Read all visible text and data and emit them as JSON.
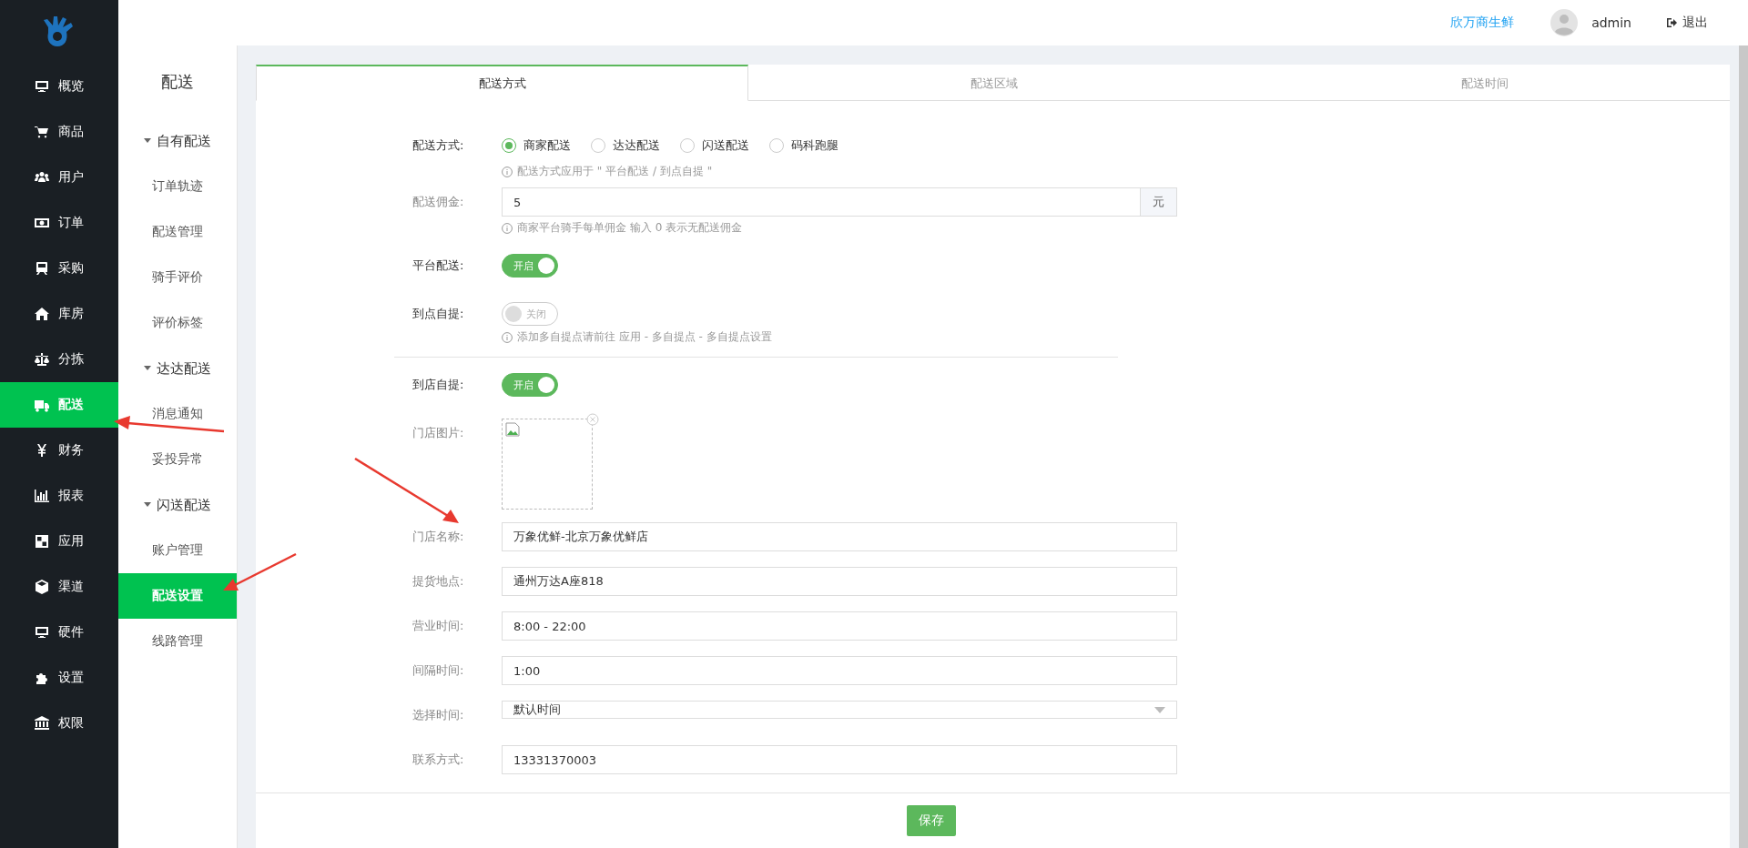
{
  "header": {
    "brand": "欣万商生鲜",
    "user": "admin",
    "logout": "退出"
  },
  "nav": [
    {
      "label": "概览",
      "selected": false
    },
    {
      "label": "商品",
      "selected": false
    },
    {
      "label": "用户",
      "selected": false
    },
    {
      "label": "订单",
      "selected": false
    },
    {
      "label": "采购",
      "selected": false
    },
    {
      "label": "库房",
      "selected": false
    },
    {
      "label": "分拣",
      "selected": false
    },
    {
      "label": "配送",
      "selected": true
    },
    {
      "label": "财务",
      "selected": false
    },
    {
      "label": "报表",
      "selected": false
    },
    {
      "label": "应用",
      "selected": false
    },
    {
      "label": "渠道",
      "selected": false
    },
    {
      "label": "硬件",
      "selected": false
    },
    {
      "label": "设置",
      "selected": false
    },
    {
      "label": "权限",
      "selected": false
    }
  ],
  "subnav": {
    "title": "配送",
    "groups": [
      {
        "label": "自有配送",
        "expanded": true,
        "children": [
          {
            "label": "订单轨迹",
            "selected": false
          },
          {
            "label": "配送管理",
            "selected": false
          },
          {
            "label": "骑手评价",
            "selected": false
          },
          {
            "label": "评价标签",
            "selected": false
          }
        ]
      },
      {
        "label": "达达配送",
        "expanded": true,
        "children": [
          {
            "label": "消息通知",
            "selected": false
          },
          {
            "label": "妥投异常",
            "selected": false
          }
        ]
      },
      {
        "label": "闪送配送",
        "expanded": true,
        "children": [
          {
            "label": "账户管理",
            "selected": false
          },
          {
            "label": "配送设置",
            "selected": true
          },
          {
            "label": "线路管理",
            "selected": false
          }
        ]
      }
    ]
  },
  "tabs": [
    {
      "label": "配送方式",
      "selected": true
    },
    {
      "label": "配送区域",
      "selected": false
    },
    {
      "label": "配送时间",
      "selected": false
    }
  ],
  "form": {
    "sections": [
      [
        {
          "kind": "radio",
          "label": "配送方式:",
          "options": [
            {
              "label": "商家配送",
              "selected": true
            },
            {
              "label": "达达配送",
              "selected": false
            },
            {
              "label": "闪送配送",
              "selected": false
            },
            {
              "label": "码科跑腿",
              "selected": false
            }
          ],
          "hint": "配送方式应用于 \" 平台配送 / 到点自提 \""
        },
        {
          "kind": "input",
          "label": "配送佣金:",
          "value": "5",
          "unit": "元",
          "hint": "商家平台骑手每单佣金 输入 0 表示无配送佣金"
        },
        {
          "kind": "switch",
          "label": "平台配送:",
          "on": true,
          "text": "开启"
        },
        {
          "kind": "switch",
          "label": "到点自提:",
          "on": false,
          "text": "关闭",
          "hint": "添加多自提点请前往 应用 - 多自提点 - 多自提点设置"
        }
      ],
      [
        {
          "kind": "switch",
          "label": "到店自提:",
          "on": true,
          "text": "开启"
        },
        {
          "kind": "image",
          "label": "门店图片:"
        },
        {
          "kind": "input",
          "label": "门店名称:",
          "value": "万象优鲜-北京万象优鲜店"
        },
        {
          "kind": "input",
          "label": "提货地点:",
          "value": "通州万达A座818"
        },
        {
          "kind": "input",
          "label": "营业时间:",
          "value": "8:00 - 22:00"
        },
        {
          "kind": "input",
          "label": "间隔时间:",
          "value": "1:00"
        },
        {
          "kind": "select",
          "label": "选择时间:",
          "value": "默认时间"
        },
        {
          "kind": "input",
          "label": "联系方式:",
          "value": "13331370003"
        }
      ]
    ],
    "save": "保存"
  }
}
